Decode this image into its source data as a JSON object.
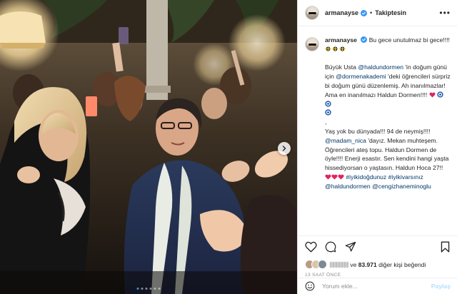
{
  "post": {
    "username": "armanayse",
    "follow_state": "Takiptesin",
    "separator": "•",
    "more": "•••"
  },
  "caption": {
    "username": "armanayse",
    "line1": "Bu gece unutulmaz bi gece!!!!",
    "p2_a": "Büyük Usta ",
    "p2_mention1": "@haldundormen",
    "p2_b": " 'in doğum günü için ",
    "p2_mention2": "@dormenakademi",
    "p2_c": " 'deki öğrencileri sürpriz bi doğum günü düzenlemiş. Ah inanılmazlar! Ama en inanılmazı Haldun Dormen!!!!",
    "p3_comma": ",",
    "p4_a": "Yaş yok bu dünyada!!! 94 de neymiş!!!! ",
    "p4_mention": "@madam_nica",
    "p4_b": " 'dayız. Mekan muhteşem. Öğrencileri ateş topu. Haldun Dormen de öyle!!!! Enerji esastır. Sen kendini hangi yaşta hissediyorsan o yaştasın. Haldun Hoca 27!! ",
    "hashtag1": "#iyikidoğdunuz",
    "hashtag2": "#iyikivarsınız",
    "mention_last1": "@haldundormen",
    "mention_last2": "@cengizhaneminoglu"
  },
  "likes": {
    "prefix_hidden": "",
    "and_text": "ve",
    "count": "83.971",
    "suffix": "diğer kişi beğendi"
  },
  "timestamp": "13 SAAT ÖNCE",
  "comment": {
    "placeholder": "Yorum ekle...",
    "post_label": "Paylaş"
  },
  "colors": {
    "link": "#00376b",
    "verified": "#3897f0",
    "post_disabled": "#b2dffc",
    "secondary_text": "#8e8e8e"
  },
  "icons": [
    "verified-badge-icon",
    "heart-icon",
    "comment-icon",
    "share-icon",
    "bookmark-icon",
    "emoji-icon",
    "chevron-right-icon",
    "red-heart-emoji",
    "nazar-emoji",
    "party-emoji"
  ]
}
